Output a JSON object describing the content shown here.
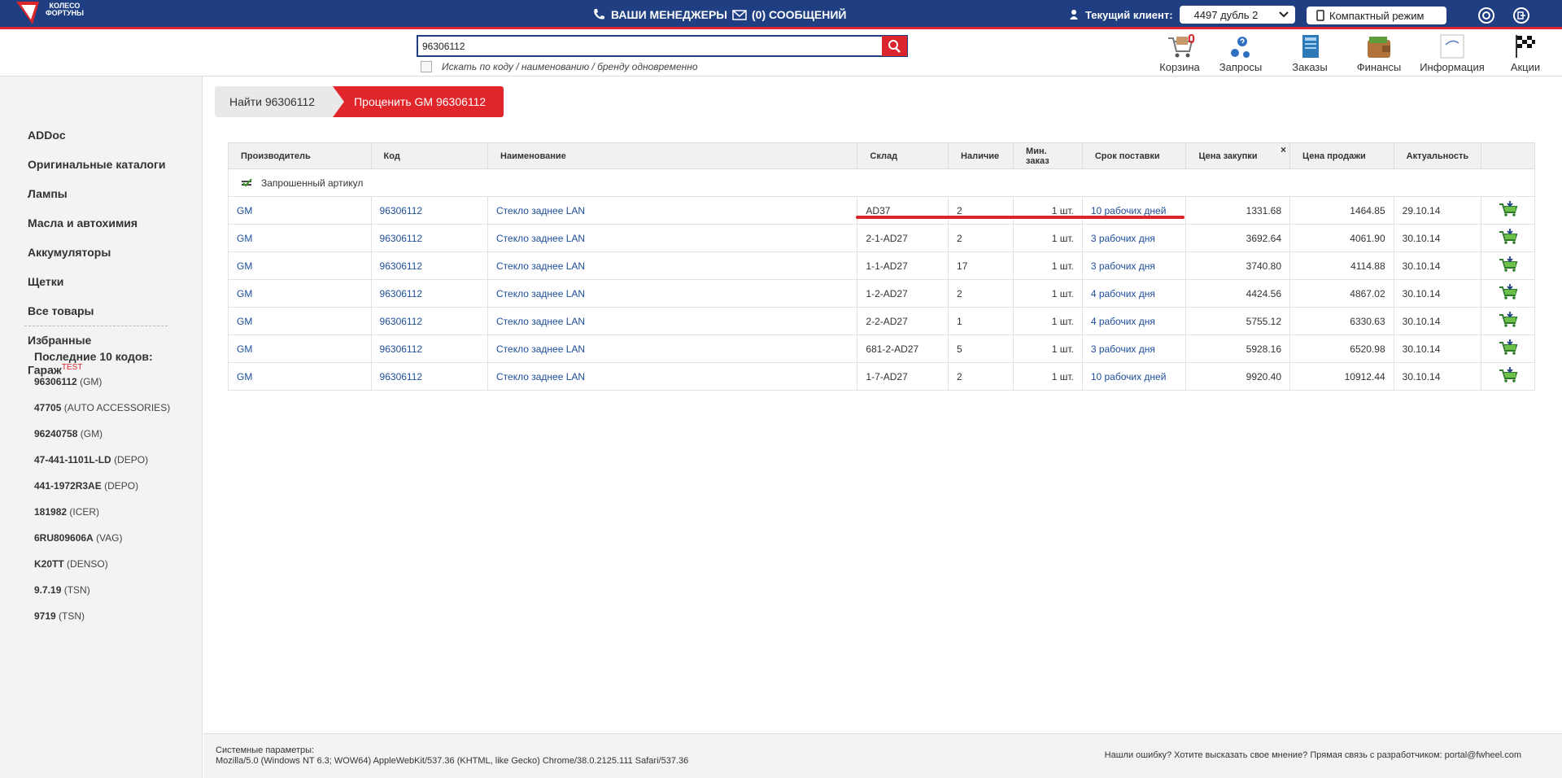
{
  "topbar": {
    "logo_text_1": "КОЛЕСО",
    "logo_text_2": "ФОРТУНЫ",
    "managers_label": "ВАШИ МЕНЕДЖЕРЫ",
    "messages_label": "(0) СООБЩЕНИЙ",
    "client_label": "Текущий клиент:",
    "client_value": "4497 дубль 2",
    "compact_label": "Компактный режим"
  },
  "search": {
    "value": "96306112",
    "checkbox_label": "Искать по коду / наименованию / бренду одновременно"
  },
  "nav": {
    "cart_label": "Корзина",
    "cart_count": "0",
    "requests_label": "Запросы",
    "orders_label": "Заказы",
    "finance_label": "Финансы",
    "info_label": "Информация",
    "promo_label": "Акции"
  },
  "sidebar": {
    "items": [
      "ADDoc",
      "Оригинальные каталоги",
      "Лампы",
      "Масла и автохимия",
      "Аккумуляторы",
      "Щетки",
      "Все товары",
      "Избранные"
    ],
    "garage_label": "Гараж",
    "garage_sup": "TEST",
    "recent_title": "Последние 10 кодов:",
    "recent": [
      {
        "code": "96306112",
        "brand": "(GM)"
      },
      {
        "code": "47705",
        "brand": "(AUTO ACCESSORIES)"
      },
      {
        "code": "96240758",
        "brand": "(GM)"
      },
      {
        "code": "47-441-1101L-LD",
        "brand": "(DEPO)"
      },
      {
        "code": "441-1972R3AE",
        "brand": "(DEPO)"
      },
      {
        "code": "181982",
        "brand": "(ICER)"
      },
      {
        "code": "6RU809606A",
        "brand": "(VAG)"
      },
      {
        "code": "K20TT",
        "brand": "(DENSO)"
      },
      {
        "code": "9.7.19",
        "brand": "(TSN)"
      },
      {
        "code": "9719",
        "brand": "(TSN)"
      }
    ]
  },
  "breadcrumb": {
    "find": "Найти 96306112",
    "price": "Проценить GM 96306112"
  },
  "table": {
    "headers": [
      "Производитель",
      "Код",
      "Наименование",
      "Склад",
      "Наличие",
      "Мин. заказ",
      "Срок поставки",
      "Цена закупки",
      "Цена продажи",
      "Актуальность"
    ],
    "close_symbol": "×",
    "group_label": "Запрошенный артикул",
    "rows": [
      {
        "maker": "GM",
        "code": "96306112",
        "name": "Стекло заднее LAN",
        "stock": "AD37",
        "qty": "2",
        "min": "1 шт.",
        "delivery": "10 рабочих дней",
        "buy": "1331.68",
        "sell": "1464.85",
        "date": "29.10.14"
      },
      {
        "maker": "GM",
        "code": "96306112",
        "name": "Стекло заднее LAN",
        "stock": "2-1-AD27",
        "qty": "2",
        "min": "1 шт.",
        "delivery": "3 рабочих дня",
        "buy": "3692.64",
        "sell": "4061.90",
        "date": "30.10.14"
      },
      {
        "maker": "GM",
        "code": "96306112",
        "name": "Стекло заднее LAN",
        "stock": "1-1-AD27",
        "qty": "17",
        "min": "1 шт.",
        "delivery": "3 рабочих дня",
        "buy": "3740.80",
        "sell": "4114.88",
        "date": "30.10.14"
      },
      {
        "maker": "GM",
        "code": "96306112",
        "name": "Стекло заднее LAN",
        "stock": "1-2-AD27",
        "qty": "2",
        "min": "1 шт.",
        "delivery": "4 рабочих дня",
        "buy": "4424.56",
        "sell": "4867.02",
        "date": "30.10.14"
      },
      {
        "maker": "GM",
        "code": "96306112",
        "name": "Стекло заднее LAN",
        "stock": "2-2-AD27",
        "qty": "1",
        "min": "1 шт.",
        "delivery": "4 рабочих дня",
        "buy": "5755.12",
        "sell": "6330.63",
        "date": "30.10.14"
      },
      {
        "maker": "GM",
        "code": "96306112",
        "name": "Стекло заднее LAN",
        "stock": "681-2-AD27",
        "qty": "5",
        "min": "1 шт.",
        "delivery": "3 рабочих дня",
        "buy": "5928.16",
        "sell": "6520.98",
        "date": "30.10.14"
      },
      {
        "maker": "GM",
        "code": "96306112",
        "name": "Стекло заднее LAN",
        "stock": "1-7-AD27",
        "qty": "2",
        "min": "1 шт.",
        "delivery": "10 рабочих дней",
        "buy": "9920.40",
        "sell": "10912.44",
        "date": "30.10.14"
      }
    ]
  },
  "footer": {
    "sys_title": "Системные параметры:",
    "sys_value": "Mozilla/5.0 (Windows NT 6.3; WOW64) AppleWebKit/537.36 (KHTML, like Gecko) Chrome/38.0.2125.111 Safari/537.36",
    "feedback": "Нашли ошибку? Хотите высказать свое мнение? Прямая связь с разработчиком: portal@fwheel.com"
  },
  "colors": {
    "brand_blue": "#1f3f82",
    "accent_red": "#d9252b",
    "link_blue": "#1d4d9a"
  }
}
